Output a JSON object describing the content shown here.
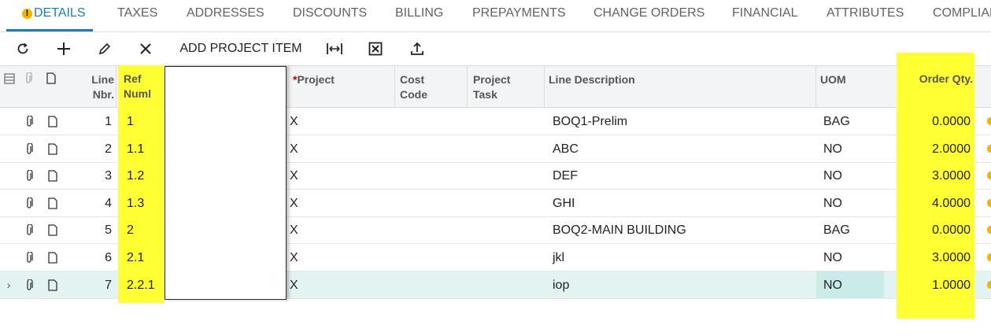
{
  "tabs": [
    {
      "label": "DETAILS",
      "active": true,
      "warning": true
    },
    {
      "label": "TAXES"
    },
    {
      "label": "ADDRESSES"
    },
    {
      "label": "DISCOUNTS"
    },
    {
      "label": "BILLING"
    },
    {
      "label": "PREPAYMENTS"
    },
    {
      "label": "CHANGE ORDERS"
    },
    {
      "label": "FINANCIAL"
    },
    {
      "label": "ATTRIBUTES"
    },
    {
      "label": "COMPLIAN"
    }
  ],
  "warning_glyph": "!",
  "toolbar": {
    "add_project_item_label": "ADD PROJECT ITEM",
    "icons": [
      "refresh-icon",
      "add-icon",
      "edit-icon",
      "delete-icon",
      "fit-columns-icon",
      "excel-export-icon",
      "upload-icon"
    ]
  },
  "grid": {
    "headers": {
      "line_nbr": [
        "Line",
        "Nbr."
      ],
      "ref_num": [
        "Ref",
        "Numl"
      ],
      "project": "Project",
      "required_mark": "*",
      "cost_code": [
        "Cost",
        "Code"
      ],
      "project_task": [
        "Project",
        "Task"
      ],
      "line_description": "Line Description",
      "uom": "UOM",
      "order_qty": "Order Qty."
    },
    "rows": [
      {
        "line": "1",
        "ref": "1",
        "project": "X",
        "description": "BOQ1-Prelim",
        "uom": "BAG",
        "qty": "0.0000"
      },
      {
        "line": "2",
        "ref": "1.1",
        "project": "X",
        "description": "ABC",
        "uom": "NO",
        "qty": "2.0000"
      },
      {
        "line": "3",
        "ref": "1.2",
        "project": "X",
        "description": "DEF",
        "uom": "NO",
        "qty": "3.0000"
      },
      {
        "line": "4",
        "ref": "1.3",
        "project": "X",
        "description": "GHI",
        "uom": "NO",
        "qty": "4.0000"
      },
      {
        "line": "5",
        "ref": "2",
        "project": "X",
        "description": "BOQ2-MAIN BUILDING",
        "uom": "BAG",
        "qty": "0.0000"
      },
      {
        "line": "6",
        "ref": "2.1",
        "project": "X",
        "description": "jkl",
        "uom": "NO",
        "qty": "3.0000"
      },
      {
        "line": "7",
        "ref": "2.2.1",
        "project": "X",
        "description": "iop",
        "uom": "NO",
        "qty": "1.0000",
        "selected": true
      }
    ]
  },
  "colors": {
    "accent": "#1a7fb5",
    "highlight": "#ffff33",
    "warning": "#f1b400",
    "selected_row": "#e3f3f2"
  }
}
